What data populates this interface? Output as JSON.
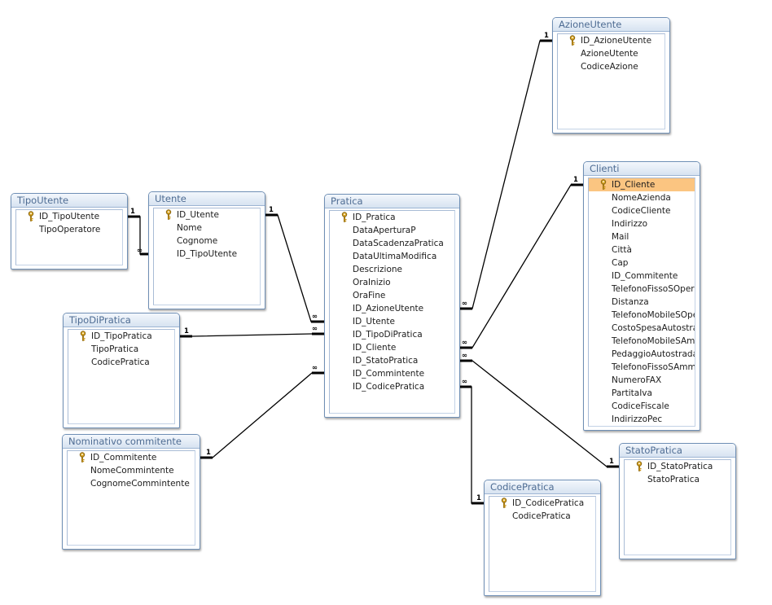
{
  "tables": [
    {
      "id": "TipoUtente",
      "title": "TipoUtente",
      "fields": [
        {
          "name": "ID_TipoUtente",
          "key": true
        },
        {
          "name": "TipoOperatore"
        }
      ]
    },
    {
      "id": "Utente",
      "title": "Utente",
      "fields": [
        {
          "name": "ID_Utente",
          "key": true
        },
        {
          "name": "Nome"
        },
        {
          "name": "Cognome"
        },
        {
          "name": "ID_TipoUtente"
        }
      ]
    },
    {
      "id": "Pratica",
      "title": "Pratica",
      "fields": [
        {
          "name": "ID_Pratica",
          "key": true
        },
        {
          "name": "DataAperturaP"
        },
        {
          "name": "DataScadenzaPratica"
        },
        {
          "name": "DataUltimaModifica"
        },
        {
          "name": "Descrizione"
        },
        {
          "name": "OraInizio"
        },
        {
          "name": "OraFine"
        },
        {
          "name": "ID_AzioneUtente"
        },
        {
          "name": "ID_Utente"
        },
        {
          "name": "ID_TipoDiPratica"
        },
        {
          "name": "ID_Cliente"
        },
        {
          "name": "ID_StatoPratica"
        },
        {
          "name": "ID_Commintente"
        },
        {
          "name": "ID_CodicePratica"
        }
      ]
    },
    {
      "id": "AzioneUtente",
      "title": "AzioneUtente",
      "fields": [
        {
          "name": "ID_AzioneUtente",
          "key": true
        },
        {
          "name": "AzioneUtente"
        },
        {
          "name": "CodiceAzione"
        }
      ]
    },
    {
      "id": "Clienti",
      "title": "Clienti",
      "fields": [
        {
          "name": "ID_Cliente",
          "key": true,
          "selected": true
        },
        {
          "name": "NomeAzienda"
        },
        {
          "name": "CodiceCliente"
        },
        {
          "name": "Indirizzo"
        },
        {
          "name": "Mail"
        },
        {
          "name": "Città"
        },
        {
          "name": "Cap"
        },
        {
          "name": "ID_Commitente"
        },
        {
          "name": "TelefonoFissoSOpera"
        },
        {
          "name": "Distanza"
        },
        {
          "name": "TelefonoMobileSOpe"
        },
        {
          "name": "CostoSpesaAutostra"
        },
        {
          "name": "TelefonoMobileSAmi"
        },
        {
          "name": "PedaggioAutostrada"
        },
        {
          "name": "TelefonoFissoSAmmi"
        },
        {
          "name": "NumeroFAX"
        },
        {
          "name": "PartitaIva"
        },
        {
          "name": "CodiceFiscale"
        },
        {
          "name": "IndirizzoPec"
        }
      ]
    },
    {
      "id": "TipoDiPratica",
      "title": "TipoDiPratica",
      "fields": [
        {
          "name": "ID_TipoPratica",
          "key": true
        },
        {
          "name": "TipoPratica"
        },
        {
          "name": "CodicePratica"
        }
      ]
    },
    {
      "id": "NominativoCommitente",
      "title": "Nominativo commitente",
      "fields": [
        {
          "name": "ID_Commitente",
          "key": true
        },
        {
          "name": "NomeCommintente"
        },
        {
          "name": "CognomeCommintente"
        }
      ]
    },
    {
      "id": "StatoPratica",
      "title": "StatoPratica",
      "fields": [
        {
          "name": "ID_StatoPratica",
          "key": true
        },
        {
          "name": "StatoPratica"
        }
      ]
    },
    {
      "id": "CodicePratica",
      "title": "CodicePratica",
      "fields": [
        {
          "name": "ID_CodicePratica",
          "key": true
        },
        {
          "name": "CodicePratica"
        }
      ]
    }
  ],
  "relationships": [
    {
      "one_table": "TipoUtente",
      "many_table": "Utente",
      "one_label": "1",
      "many_label": "∞"
    },
    {
      "one_table": "Utente",
      "many_table": "Pratica",
      "one_label": "1",
      "many_label": "∞"
    },
    {
      "one_table": "TipoDiPratica",
      "many_table": "Pratica",
      "one_label": "1",
      "many_label": "∞"
    },
    {
      "one_table": "NominativoCommitente",
      "many_table": "Pratica",
      "one_label": "1",
      "many_label": "∞"
    },
    {
      "one_table": "AzioneUtente",
      "many_table": "Pratica",
      "one_label": "1",
      "many_label": "∞"
    },
    {
      "one_table": "Clienti",
      "many_table": "Pratica",
      "one_label": "1",
      "many_label": "∞"
    },
    {
      "one_table": "StatoPratica",
      "many_table": "Pratica",
      "one_label": "1",
      "many_label": "∞"
    },
    {
      "one_table": "CodicePratica",
      "many_table": "Pratica",
      "one_label": "1",
      "many_label": "∞"
    }
  ],
  "colors": {
    "title_text": "#4e6c93",
    "border": "#6f8fb5",
    "selected_field": "#fbc581",
    "line": "#000000"
  },
  "icons": {
    "primary_key": "key-icon"
  }
}
